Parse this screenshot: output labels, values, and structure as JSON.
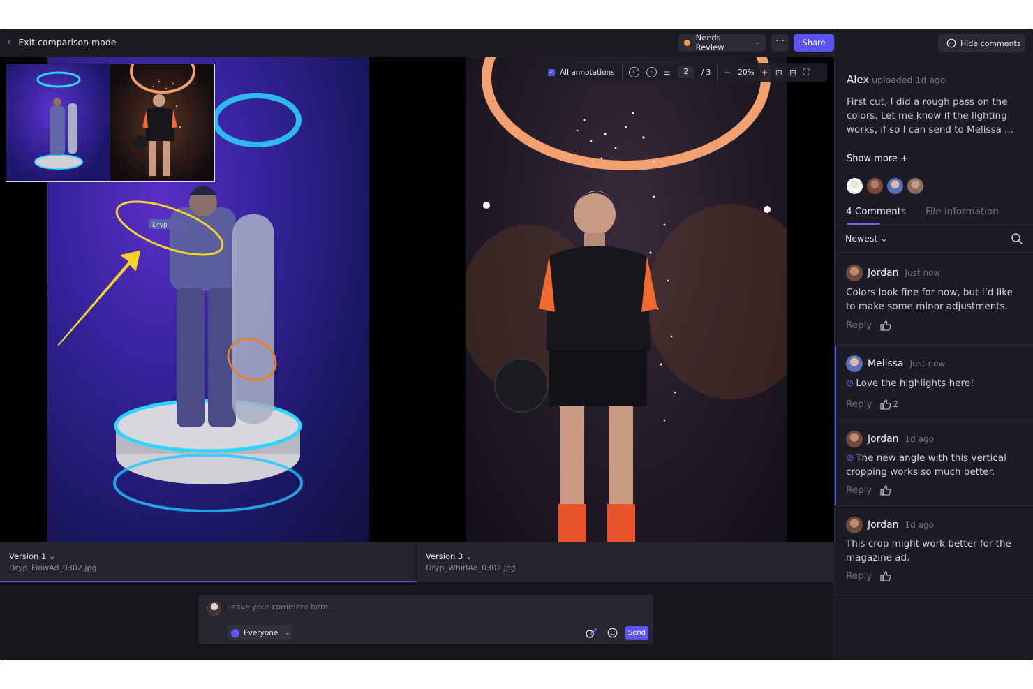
{
  "topbar": {
    "exit_label": "Exit comparison mode",
    "status": "Needs Review",
    "more_label": "···",
    "share_label": "Share"
  },
  "panel": {
    "hide_label": "Hide comments",
    "uploader": {
      "name": "Alex",
      "meta": "uploaded 1d ago"
    },
    "upload_text": "First cut, I did a rough pass on the colors. Let me know if the lighting works, if so I can send to Melissa ...",
    "show_more": "Show more +",
    "tabs": {
      "comments": "4 Comments",
      "info": "File information"
    },
    "sort": "Newest ⌄",
    "comments": [
      {
        "name": "Jordan",
        "time": "Just now",
        "text": "Colors look fine for now, but I’d like to make some minor adjustments.",
        "reply": "Reply",
        "likes": "",
        "resolved": false
      },
      {
        "name": "Melissa",
        "time": "Just now",
        "text": "Love the highlights here!",
        "reply": "Reply",
        "likes": "2",
        "resolved": true
      },
      {
        "name": "Jordan",
        "time": "1d ago",
        "text": "The new angle with this vertical cropping works so much better.",
        "reply": "Reply",
        "likes": "",
        "resolved": true
      },
      {
        "name": "Jordan",
        "time": "1d ago",
        "text": "This crop might work better for the magazine ad.",
        "reply": "Reply",
        "likes": "",
        "resolved": false
      }
    ]
  },
  "toolbar": {
    "annotations_label": "All annotations",
    "page_current": "2",
    "page_total": "/ 3",
    "zoom": "20%"
  },
  "versions": [
    {
      "title": "Version 1 ⌄",
      "file": "Dryp_FlowAd_0302.jpg"
    },
    {
      "title": "Version 3 ⌄",
      "file": "Dryp_WhirlAd_0302.jpg"
    }
  ],
  "composer": {
    "placeholder": "Leave your comment here...",
    "audience": "Everyone",
    "send_label": "Send"
  },
  "colors": {
    "accent": "#5b55f5",
    "status": "#f2994a",
    "annotation_yellow": "#f5d22a",
    "annotation_orange": "#e8801f"
  }
}
